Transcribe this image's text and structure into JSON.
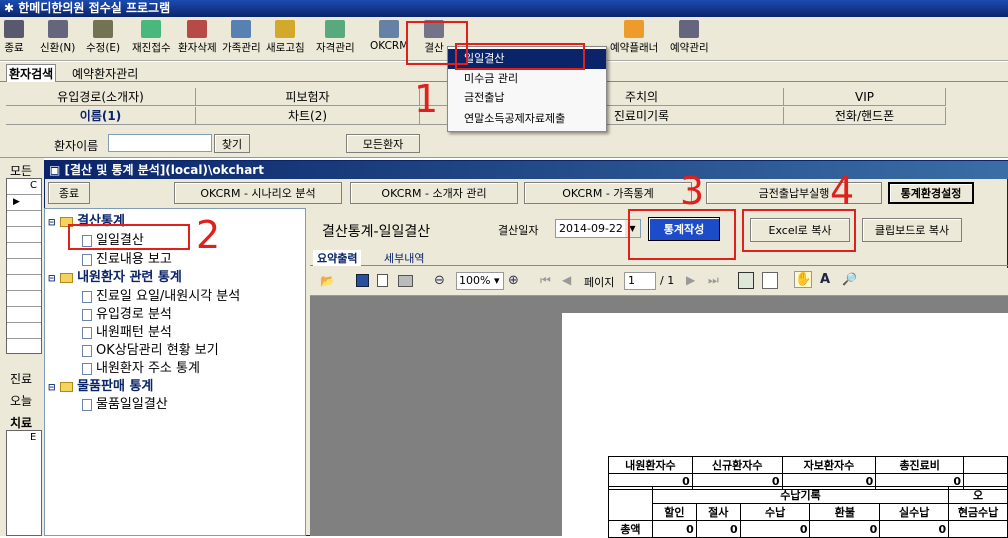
{
  "app": {
    "title": "한메디한의원 접수실 프로그램"
  },
  "toolbar": [
    {
      "label": "종료",
      "icon": "exit-icon"
    },
    {
      "label": "신환(N)",
      "icon": "new-patient-icon"
    },
    {
      "label": "수정(E)",
      "icon": "edit-icon"
    },
    {
      "label": "재진접수",
      "icon": "revisit-icon"
    },
    {
      "label": "환자삭제",
      "icon": "delete-patient-icon"
    },
    {
      "label": "가족관리",
      "icon": "family-icon"
    },
    {
      "label": "새로고침",
      "icon": "refresh-icon"
    },
    {
      "label": "자격관리",
      "icon": "qualification-icon"
    },
    {
      "label": "OKCRM",
      "icon": "okcrm-icon"
    },
    {
      "label": "결산",
      "icon": "settlement-icon"
    },
    {
      "label": "예약플래너",
      "icon": "planner-icon"
    },
    {
      "label": "예약관리",
      "icon": "calendar-icon"
    }
  ],
  "dropdown": {
    "items": [
      "일일결산",
      "미수금 관리",
      "금전출납",
      "연말소득공제자료제출"
    ]
  },
  "tabs": {
    "patient_search": "환자검색",
    "reservation": "예약환자관리"
  },
  "search_grid": {
    "row1": [
      "유입경로(소개자)",
      "피보험자",
      "",
      "주치의",
      "VIP"
    ],
    "row2": [
      "이름(1)",
      "차트(2)",
      "",
      "진료미기록",
      "전화/핸드폰"
    ]
  },
  "search": {
    "label": "환자이름",
    "find": "찾기",
    "all": "모든환자"
  },
  "left_labels": {
    "a": "모든",
    "b": "진료",
    "c": "오늘",
    "d": "치료",
    "e": "C",
    "f": "E"
  },
  "inner": {
    "title": "[결산 및 통계 분석](local)\\okchart",
    "buttons": {
      "exit": "종료",
      "scenario": "OKCRM - 시나리오 분석",
      "referrer": "OKCRM - 소개자 관리",
      "family": "OKCRM - 가족통계",
      "cash": "금전출납부실행",
      "env": "통계환경설정"
    }
  },
  "tree": {
    "g1": "결산통계",
    "i1": "일일결산",
    "i2": "진료내용 보고",
    "g2": "내원환자 관련 통계",
    "i3": "진료일 요일/내원시각 분석",
    "i4": "유입경로 분석",
    "i5": "내원패턴 분석",
    "i6": "OK상담관리 현황 보기",
    "i7": "내원환자 주소 통계",
    "g3": "물품판매 통계",
    "i8": "물품일일결산"
  },
  "report": {
    "heading": "결산통계-일일결산",
    "date_label": "결산일자",
    "date": "2014-09-22",
    "make": "통계작성",
    "excel": "Excel로 복사",
    "clip": "클립보드로 복사",
    "tab1": "요약출력",
    "tab2": "세부내역",
    "zoom": "100%",
    "page_label": "페이지",
    "page": "1",
    "total": "/ 1"
  },
  "summary": {
    "headers": [
      "내원환자수",
      "신규환자수",
      "자보환자수",
      "총진료비"
    ],
    "values": [
      "0",
      "0",
      "0",
      "0"
    ],
    "sub_title": "수납기록",
    "sub_headers": [
      "할인",
      "절사",
      "수납",
      "환불",
      "실수납",
      "현금수납"
    ],
    "row_label": "총액",
    "row_values": [
      "0",
      "0",
      "0",
      "0",
      "0"
    ],
    "col_o": "오"
  },
  "annotations": [
    "1",
    "2",
    "3",
    "4"
  ],
  "colors": {
    "titlebar": "#0a246a",
    "button_face": "#ece9d8",
    "annotation": "#e0201c",
    "menu_highlight": "#0a246a"
  }
}
